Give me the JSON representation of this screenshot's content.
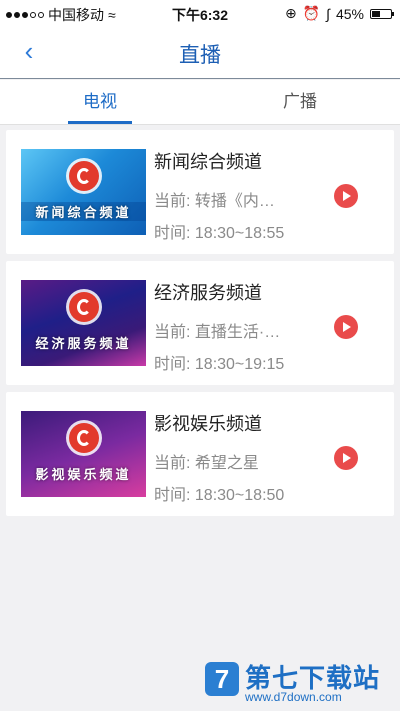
{
  "status_bar": {
    "carrier": "中国移动",
    "time": "下午6:32",
    "battery": "45%",
    "battery_level": 0.45
  },
  "nav": {
    "back_icon": "chevron-left-icon",
    "title": "直播"
  },
  "tabs": [
    {
      "label": "电视",
      "active": true
    },
    {
      "label": "广播",
      "active": false
    }
  ],
  "channels": [
    {
      "name": "新闻综合频道",
      "current": "当前: 转播《内…",
      "time": "时间: 18:30~18:55",
      "thumb_label": "新闻综合频道"
    },
    {
      "name": "经济服务频道",
      "current": "当前: 直播生活·…",
      "time": "时间: 18:30~19:15",
      "thumb_label": "经济服务频道"
    },
    {
      "name": "影视娱乐频道",
      "current": "当前: 希望之星",
      "time": "时间: 18:30~18:50",
      "thumb_label": "影视娱乐频道"
    }
  ],
  "watermark": {
    "brand": "第七下载站",
    "url": "www.d7down.com",
    "icon_letter": "7"
  },
  "colors": {
    "accent": "#1d6bc6",
    "play": "#e94b4b",
    "background": "#f1f1f3"
  }
}
